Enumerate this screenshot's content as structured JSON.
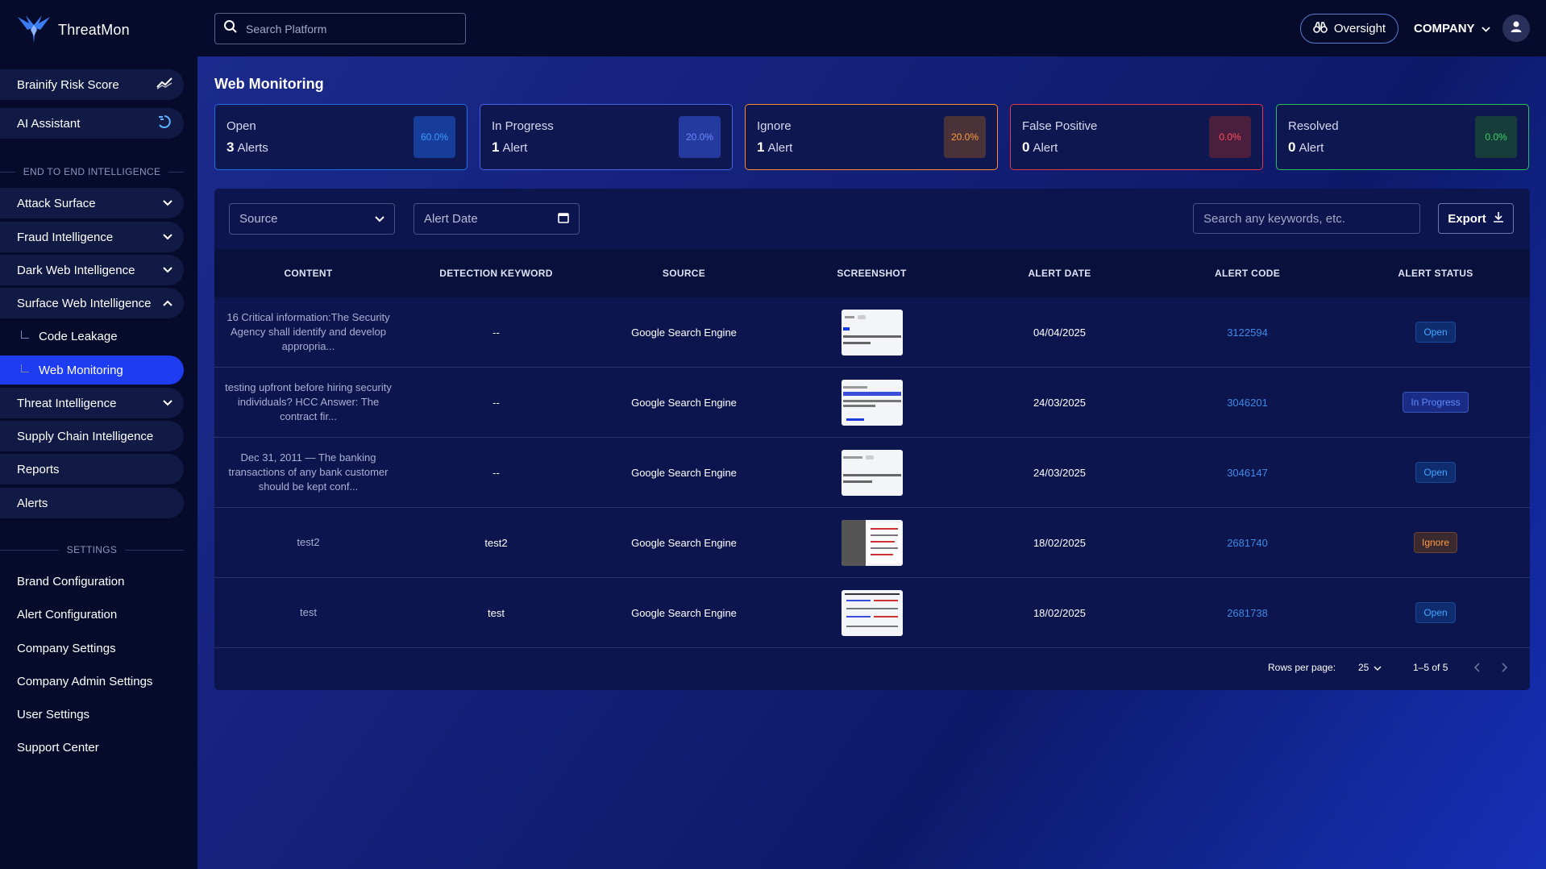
{
  "app": {
    "name": "ThreatMon"
  },
  "topbar": {
    "search_placeholder": "Search Platform",
    "oversight_label": "Oversight",
    "company_label": "COMPANY"
  },
  "sidebar": {
    "top_items": [
      {
        "label": "Brainify Risk Score",
        "icon": "trend-chart-icon"
      },
      {
        "label": "AI Assistant",
        "icon": "ai-sparkle-icon"
      }
    ],
    "section_e2e": "END TO END INTELLIGENCE",
    "items": [
      {
        "label": "Attack Surface"
      },
      {
        "label": "Fraud Intelligence"
      },
      {
        "label": "Dark Web Intelligence"
      },
      {
        "label": "Surface Web Intelligence"
      },
      {
        "label": "Code Leakage"
      },
      {
        "label": "Web Monitoring"
      },
      {
        "label": "Threat Intelligence"
      },
      {
        "label": "Supply Chain Intelligence"
      },
      {
        "label": "Reports"
      },
      {
        "label": "Alerts"
      }
    ],
    "section_settings": "SETTINGS",
    "settings": [
      {
        "label": "Brand Configuration"
      },
      {
        "label": "Alert Configuration"
      },
      {
        "label": "Company Settings"
      },
      {
        "label": "Company Admin Settings"
      },
      {
        "label": "User Settings"
      },
      {
        "label": "Support Center"
      }
    ]
  },
  "main": {
    "title": "Web Monitoring",
    "cards": [
      {
        "label": "Open",
        "count": "3",
        "unit": "Alerts",
        "percent": "60.0%",
        "color": "#1e6fe6"
      },
      {
        "label": "In Progress",
        "count": "1",
        "unit": "Alert",
        "percent": "20.0%",
        "color": "#4a63e6"
      },
      {
        "label": "Ignore",
        "count": "1",
        "unit": "Alert",
        "percent": "20.0%",
        "color": "#ff8c2e"
      },
      {
        "label": "False Positive",
        "count": "0",
        "unit": "Alert",
        "percent": "0.0%",
        "color": "#e63a4a"
      },
      {
        "label": "Resolved",
        "count": "0",
        "unit": "Alert",
        "percent": "0.0%",
        "color": "#2dbf5a"
      }
    ],
    "filters": {
      "source_label": "Source",
      "date_label": "Alert Date",
      "search_placeholder": "Search any keywords, etc.",
      "export_label": "Export"
    },
    "table": {
      "columns": [
        "CONTENT",
        "DETECTION KEYWORD",
        "SOURCE",
        "SCREENSHOT",
        "ALERT DATE",
        "ALERT CODE",
        "ALERT STATUS"
      ],
      "rows": [
        {
          "content": "16 Critical information:The Security Agency shall identify and develop appropria...",
          "keyword": "--",
          "source": "Google Search Engine",
          "date": "04/04/2025",
          "code": "3122594",
          "status": "Open"
        },
        {
          "content": "testing upfront before hiring security individuals? HCC Answer: The contract fir...",
          "keyword": "--",
          "source": "Google Search Engine",
          "date": "24/03/2025",
          "code": "3046201",
          "status": "In Progress"
        },
        {
          "content": "Dec 31, 2011 — The banking transactions of any bank customer should be kept conf...",
          "keyword": "--",
          "source": "Google Search Engine",
          "date": "24/03/2025",
          "code": "3046147",
          "status": "Open"
        },
        {
          "content": "test2",
          "keyword": "test2",
          "source": "Google Search Engine",
          "date": "18/02/2025",
          "code": "2681740",
          "status": "Ignore"
        },
        {
          "content": "test",
          "keyword": "test",
          "source": "Google Search Engine",
          "date": "18/02/2025",
          "code": "2681738",
          "status": "Open"
        }
      ]
    },
    "pagination": {
      "rows_per_page_label": "Rows per page:",
      "rows_per_page": "25",
      "range": "1–5 of 5"
    }
  }
}
